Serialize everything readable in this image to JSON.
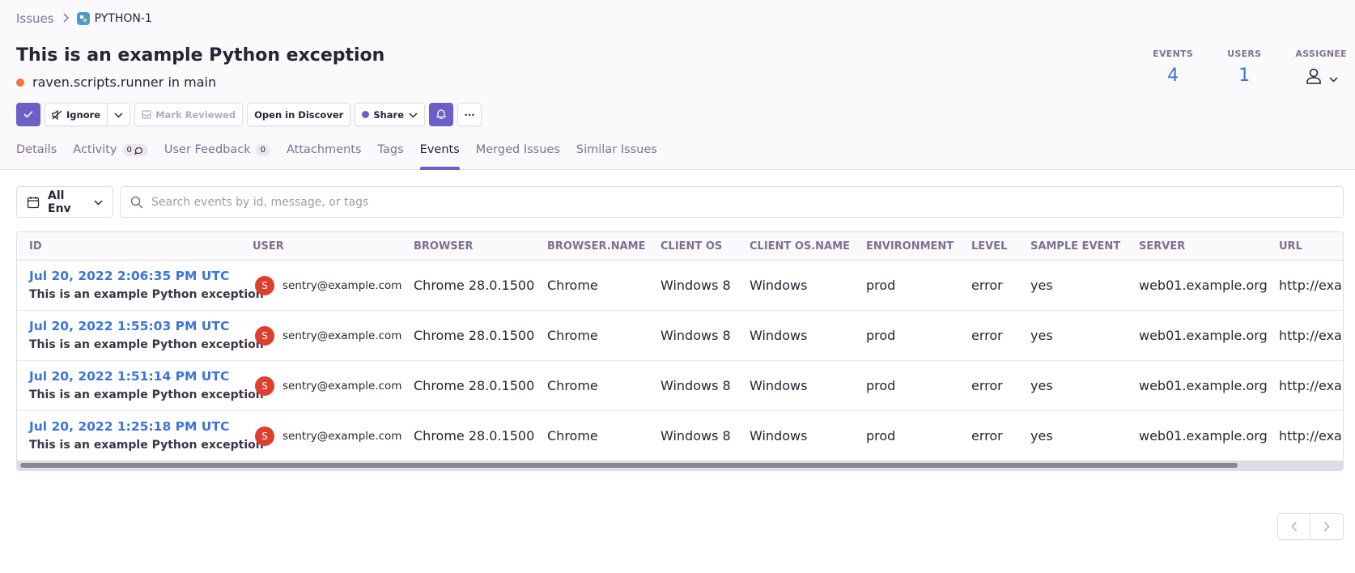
{
  "breadcrumb": {
    "parent": "Issues",
    "project": "PYTHON-1"
  },
  "issue": {
    "title": "This is an example Python exception",
    "culprit": "raven.scripts.runner in main",
    "level_color": "#f2753a"
  },
  "stats": {
    "events_label": "EVENTS",
    "events_value": "4",
    "users_label": "USERS",
    "users_value": "1",
    "assignee_label": "ASSIGNEE"
  },
  "actions": {
    "ignore": "Ignore",
    "mark_reviewed": "Mark Reviewed",
    "open_discover": "Open in Discover",
    "share": "Share",
    "more": "···"
  },
  "tabs": [
    {
      "label": "Details"
    },
    {
      "label": "Activity",
      "badge": "0"
    },
    {
      "label": "User Feedback",
      "badge": "0"
    },
    {
      "label": "Attachments"
    },
    {
      "label": "Tags"
    },
    {
      "label": "Events",
      "active": true
    },
    {
      "label": "Merged Issues"
    },
    {
      "label": "Similar Issues"
    }
  ],
  "filters": {
    "env": "All Env",
    "search_placeholder": "Search events by id, message, or tags"
  },
  "table": {
    "columns": [
      "ID",
      "USER",
      "BROWSER",
      "BROWSER.NAME",
      "CLIENT OS",
      "CLIENT OS.NAME",
      "ENVIRONMENT",
      "LEVEL",
      "SAMPLE EVENT",
      "SERVER",
      "URL"
    ],
    "rows": [
      {
        "id": "Jul 20, 2022 2:06:35 PM UTC",
        "message": "This is an example Python exception",
        "user_initial": "S",
        "user": "sentry@example.com",
        "browser": "Chrome 28.0.1500",
        "browser_name": "Chrome",
        "client_os": "Windows 8",
        "client_os_name": "Windows",
        "environment": "prod",
        "level": "error",
        "sample_event": "yes",
        "server": "web01.example.org",
        "url": "http://example.com/foo"
      },
      {
        "id": "Jul 20, 2022 1:55:03 PM UTC",
        "message": "This is an example Python exception",
        "user_initial": "S",
        "user": "sentry@example.com",
        "browser": "Chrome 28.0.1500",
        "browser_name": "Chrome",
        "client_os": "Windows 8",
        "client_os_name": "Windows",
        "environment": "prod",
        "level": "error",
        "sample_event": "yes",
        "server": "web01.example.org",
        "url": "http://example.com/foo"
      },
      {
        "id": "Jul 20, 2022 1:51:14 PM UTC",
        "message": "This is an example Python exception",
        "user_initial": "S",
        "user": "sentry@example.com",
        "browser": "Chrome 28.0.1500",
        "browser_name": "Chrome",
        "client_os": "Windows 8",
        "client_os_name": "Windows",
        "environment": "prod",
        "level": "error",
        "sample_event": "yes",
        "server": "web01.example.org",
        "url": "http://example.com/foo"
      },
      {
        "id": "Jul 20, 2022 1:25:18 PM UTC",
        "message": "This is an example Python exception",
        "user_initial": "S",
        "user": "sentry@example.com",
        "browser": "Chrome 28.0.1500",
        "browser_name": "Chrome",
        "client_os": "Windows 8",
        "client_os_name": "Windows",
        "environment": "prod",
        "level": "error",
        "sample_event": "yes",
        "server": "web01.example.org",
        "url": "http://example.com/foo"
      }
    ]
  },
  "colors": {
    "accent": "#6c5fc7",
    "link": "#3d74db",
    "avatar": "#e03e2f"
  }
}
